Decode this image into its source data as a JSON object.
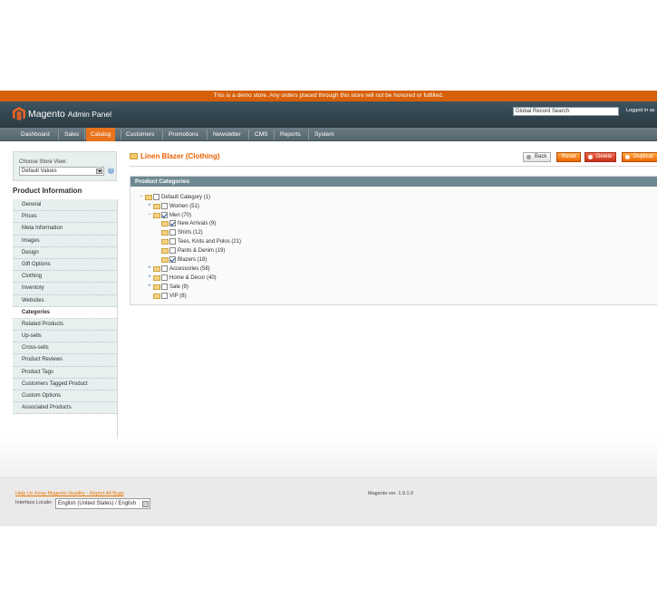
{
  "demo_notice": "This is a demo store. Any orders placed through this store will not be honored or fulfilled.",
  "header": {
    "logo_text": "Magento",
    "logo_sub": "Admin Panel",
    "search_value": "Global Record Search",
    "logged_in": "Logged in as"
  },
  "nav": {
    "items": [
      {
        "label": "Dashboard"
      },
      {
        "label": "Sales"
      },
      {
        "label": "Catalog",
        "active": true
      },
      {
        "label": "Customers"
      },
      {
        "label": "Promotions"
      },
      {
        "label": "Newsletter"
      },
      {
        "label": "CMS"
      },
      {
        "label": "Reports"
      },
      {
        "label": "System"
      }
    ]
  },
  "store": {
    "label": "Choose Store View:",
    "value": "Default Values"
  },
  "sidebar": {
    "title": "Product Information",
    "tabs": [
      "General",
      "Prices",
      "Meta Information",
      "Images",
      "Design",
      "Gift Options",
      "Clothing",
      "Inventory",
      "Websites",
      "Categories",
      "Related Products",
      "Up-sells",
      "Cross-sells",
      "Product Reviews",
      "Product Tags",
      "Customers Tagged Product",
      "Custom Options",
      "Associated Products"
    ],
    "active_tab": "Categories"
  },
  "form": {
    "title": "Linen Blazer (Clothing)",
    "buttons": {
      "back": "Back",
      "reset": "Reset",
      "delete": "Delete",
      "duplicate": "Duplicat"
    },
    "fieldset_title": "Product Categories"
  },
  "tree": [
    {
      "label": "Default Category (1)",
      "toggle": "−",
      "checked": false,
      "depth": 0
    },
    {
      "label": "Women (51)",
      "toggle": "+",
      "checked": false,
      "depth": 1
    },
    {
      "label": "Men (70)",
      "toggle": "−",
      "checked": true,
      "depth": 1
    },
    {
      "label": "New Arrivals (9)",
      "toggle": "",
      "checked": true,
      "depth": 2
    },
    {
      "label": "Shirts (12)",
      "toggle": "",
      "checked": false,
      "depth": 2
    },
    {
      "label": "Tees, Knits and Polos (21)",
      "toggle": "",
      "checked": false,
      "depth": 2
    },
    {
      "label": "Pants & Denim (19)",
      "toggle": "",
      "checked": false,
      "depth": 2
    },
    {
      "label": "Blazers (18)",
      "toggle": "",
      "checked": true,
      "depth": 2
    },
    {
      "label": "Accessories (58)",
      "toggle": "+",
      "checked": false,
      "depth": 1
    },
    {
      "label": "Home & Decor (40)",
      "toggle": "+",
      "checked": false,
      "depth": 1
    },
    {
      "label": "Sale (9)",
      "toggle": "+",
      "checked": false,
      "depth": 1
    },
    {
      "label": "VIP (8)",
      "toggle": "",
      "checked": false,
      "depth": 1
    }
  ],
  "footer": {
    "bug_link": "Help Us Keep Magento Healthy - Report All Bugs",
    "version": "Magento ver. 1.9.1.0",
    "locale_label": "Interface Locale:",
    "locale_value": "English (United States) / English"
  },
  "colors": {
    "accent": "#eb5e00",
    "header_bg": "#2f414a",
    "nav_bg": "#5f6f77",
    "fieldset_head": "#6f8992"
  }
}
